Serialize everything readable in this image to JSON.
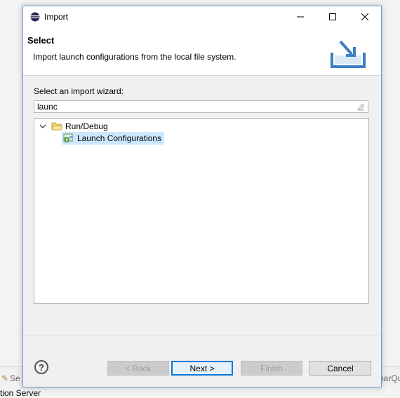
{
  "background": {
    "left_fragment": "Se",
    "right_fragment": "narQu",
    "bottom_text": "tion Server"
  },
  "dialog": {
    "title": "Import",
    "header": {
      "title": "Select",
      "description": "Import launch configurations from the local file system."
    },
    "wizard_label": "Select an import wizard:",
    "filter": {
      "value": "launc",
      "placeholder": ""
    },
    "tree": [
      {
        "label": "Run/Debug",
        "expanded": true,
        "icon": "folder-open-icon",
        "children": [
          {
            "label": "Launch Configurations",
            "selected": true,
            "icon": "launch-config-icon"
          }
        ]
      }
    ],
    "buttons": {
      "help": "?",
      "back": "< Back",
      "next": "Next >",
      "finish": "Finish",
      "cancel": "Cancel"
    }
  },
  "colors": {
    "selection": "#cce8ff",
    "default_button_border": "#0078d7",
    "dialog_border": "#6b9bd1"
  }
}
